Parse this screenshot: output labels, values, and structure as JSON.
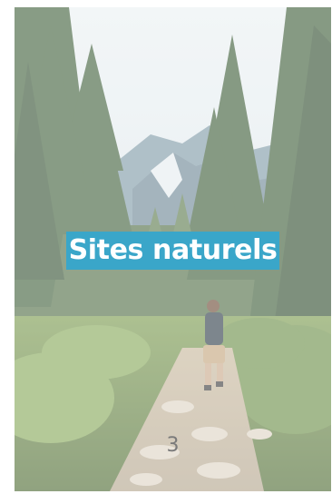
{
  "card": {
    "title": "Sites naturels",
    "page_number": "3"
  },
  "image": {
    "subject": "hiker-walking-on-forest-mountain-trail"
  },
  "colors": {
    "title_background": "#3aa6c9",
    "title_text": "#ffffff",
    "page_number": "#7a7a7a"
  }
}
